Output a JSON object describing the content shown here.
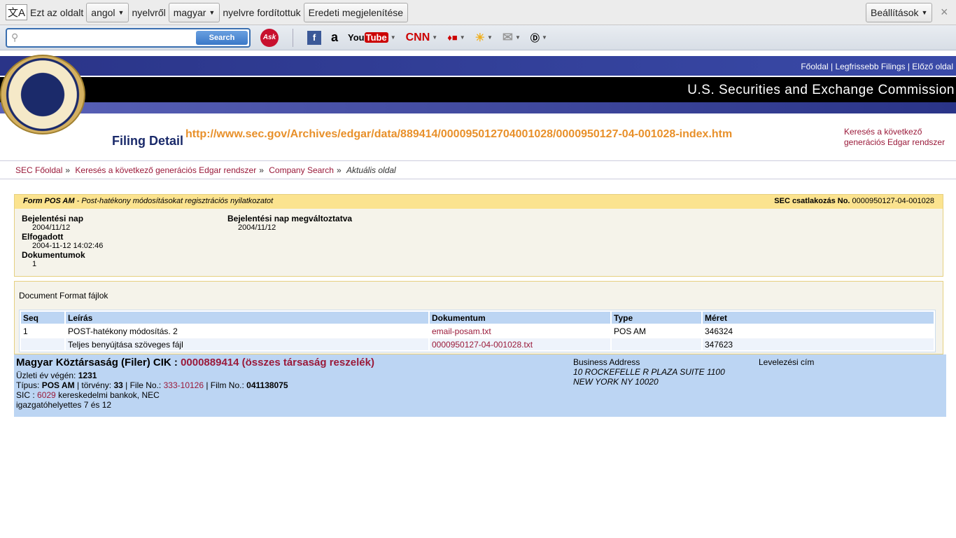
{
  "translate_bar": {
    "prefix": "Ezt az oldalt",
    "from_lang": "angol",
    "mid": "nyelvről",
    "to_lang": "magyar",
    "suffix": "nyelvre fordítottuk",
    "show_original": "Eredeti megjelenítése",
    "settings": "Beállítások",
    "close": "×"
  },
  "toolbar": {
    "search_placeholder": "",
    "search_button": "Search",
    "icons": [
      "ask",
      "facebook",
      "amazon",
      "youtube",
      "cnn",
      "games",
      "weather",
      "mail",
      "dictionary"
    ]
  },
  "header": {
    "nav": "Főoldal | Legfrissebb Filings | Előző oldal",
    "agency": "U.S. Securities and Exchange Commission",
    "seal_text": "U.S. SECURITIES AND EXCHANGE COMMISSION MCMXXXIV",
    "page_title": "Filing Detail",
    "url": "http://www.sec.gov/Archives/edgar/data/889414/000095012704001028/0000950127-04-001028-index.htm",
    "edgar_link_1": "Keresés a következő",
    "edgar_link_2": "generációs Edgar rendszer"
  },
  "breadcrumb": [
    {
      "label": "SEC Főoldal"
    },
    {
      "label": "Keresés a következő generációs Edgar rendszer"
    },
    {
      "label": "Company Search"
    },
    {
      "label": "Aktuális oldal"
    }
  ],
  "breadcrumb_sep": "»",
  "form": {
    "form_type": "Form POS AM",
    "form_desc": " - Post-hatékony módosításokat regisztrációs nyilatkozatot",
    "accession_label": "SEC csatlakozás No.",
    "accession": "0000950127-04-001028",
    "filing_date_label": "Bejelentési nap",
    "filing_date": "2004/11/12",
    "accepted_label": "Elfogadott",
    "accepted": "2004-11-12 14:02:46",
    "docs_label": "Dokumentumok",
    "docs": "1",
    "changed_label": "Bejelentési nap megváltoztatva",
    "changed": "2004/11/12"
  },
  "documents": {
    "title": "Document Format fájlok",
    "headers": [
      "Seq",
      "Leírás",
      "Dokumentum",
      "Type",
      "Méret"
    ],
    "rows": [
      [
        "1",
        "POST-hatékony módosítás. 2",
        "email-posam.txt",
        "POS AM",
        "346324"
      ],
      [
        "",
        "Teljes benyújtása szöveges fájl",
        "0000950127-04-001028.txt",
        "",
        "347623"
      ]
    ]
  },
  "company": {
    "name": "Magyar Köztársaság (Filer) CIK :",
    "cik": "0000889414 (összes társaság reszelék)",
    "fy_label": "Üzleti év végén:",
    "fy": "1231",
    "type_label": "Típus:",
    "type": "POS AM",
    "act_label": "| törvény:",
    "act": "33",
    "fileno_label": "| File No.:",
    "fileno": "333-10126",
    "film_label": "| Film No.:",
    "film": "041138075",
    "sic_label": "SIC :",
    "sic": "6029",
    "sic_desc": "kereskedelmi bankok, NEC",
    "office": "igazgatóhelyettes 7 és 12",
    "biz_label": "Business Address",
    "biz_1": "10 ROCKEFELLE R PLAZA SUITE 1100",
    "biz_2": "NEW YORK NY 10020",
    "mail_label": "Levelezési cím"
  },
  "colors": {
    "accent_link": "#9a1a3a",
    "url": "#e8902a",
    "header_blue": "#2a3488",
    "table_header": "#bcd5f3",
    "form_header": "#fbe38f"
  }
}
